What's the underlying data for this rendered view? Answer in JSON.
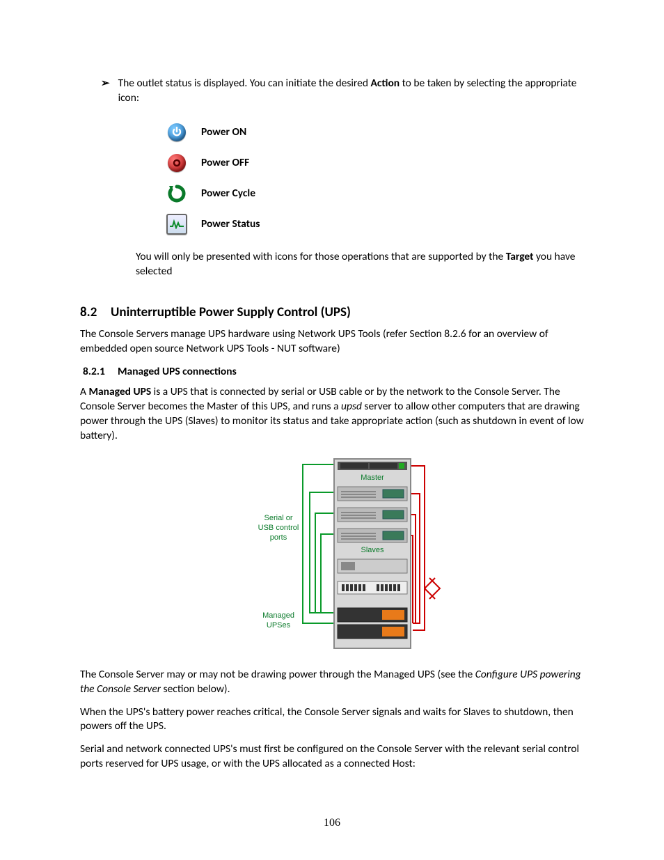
{
  "bullet": {
    "text_before_bold": "The outlet status is displayed. You can initiate the desired ",
    "bold1": "Action",
    "text_after_bold": " to be taken by selecting the appropriate icon:"
  },
  "icons": {
    "power_on": "Power ON",
    "power_off": "Power OFF",
    "power_cycle": "Power Cycle",
    "power_status": "Power Status"
  },
  "followup": {
    "before_bold": "You will only be presented with icons for those operations that are supported by the ",
    "bold": "Target",
    "after_bold": " you have selected"
  },
  "section": {
    "num": "8.2",
    "title": "Uninterruptible Power Supply Control (UPS)"
  },
  "section_intro": "The Console Servers manage UPS hardware using Network UPS Tools (refer Section 8.2.6 for an overview of embedded open source Network UPS Tools - NUT software)",
  "subsection": {
    "num": "8.2.1",
    "title": "Managed UPS connections"
  },
  "managed_para": {
    "p1_a": "A ",
    "p1_bold": "Managed UPS",
    "p1_b": " is a UPS that is connected by serial or USB cable or by the network to the Console Server. The Console Server becomes the Master of this UPS, and runs a ",
    "p1_italic": "upsd",
    "p1_c": " server to allow other computers that are drawing power through the UPS (Slaves) to monitor its status and take appropriate action (such as shutdown in event of low battery)."
  },
  "diagram_labels": {
    "master": "Master",
    "slaves": "Slaves",
    "left1a": "Serial or",
    "left1b": "USB control",
    "left1c": "ports",
    "left2a": "Managed",
    "left2b": "UPSes"
  },
  "after_diagram": {
    "p1_a": "The Console Server may or may not be drawing power through the Managed UPS (see the ",
    "p1_italic": "Configure UPS powering the Console Server",
    "p1_b": " section below).",
    "p2": "When the UPS's battery power reaches critical, the Console Server signals and waits for Slaves to shutdown, then powers off the UPS.",
    "p3": "Serial and network connected UPS's must first be configured on the Console Server with the relevant serial control ports reserved for UPS usage, or with the UPS allocated as a connected Host:"
  },
  "page_number": "106"
}
